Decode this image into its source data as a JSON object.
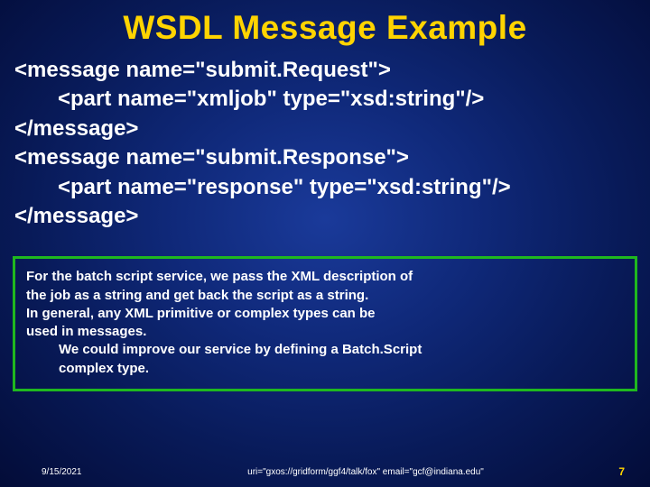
{
  "title": "WSDL Message Example",
  "code": {
    "l1": "<message name=\"submit.Request\">",
    "l2": "<part name=\"xmljob\" type=\"xsd:string\"/>",
    "l3": "</message>",
    "l4": "<message name=\"submit.Response\">",
    "l5": "<part name=\"response\" type=\"xsd:string\"/>",
    "l6": "</message>"
  },
  "info": {
    "p1a": "For the batch script service, we pass the XML description of",
    "p1b": "the job as a string and get back the script as a string.",
    "p2a": "In general, any XML primitive or complex types can be",
    "p2b": "used in messages.",
    "p3a": "We could improve our service by defining a Batch.Script",
    "p3b": "complex type."
  },
  "footer": {
    "date": "9/15/2021",
    "uri": "uri=\"gxos://gridform/ggf4/talk/fox\" email=\"gcf@indiana.edu\"",
    "page": "7"
  }
}
